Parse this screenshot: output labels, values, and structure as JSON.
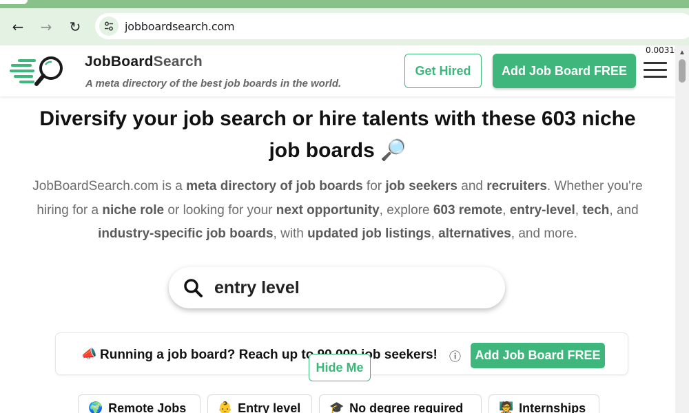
{
  "browser": {
    "back_glyph": "←",
    "forward_glyph": "→",
    "reload_glyph": "↻",
    "url": "jobboardsearch.com"
  },
  "header": {
    "brand_main": "JobBoard",
    "brand_accent": "Search",
    "tagline": "A meta directory of the best job boards in the world.",
    "get_hired_label": "Get Hired",
    "add_board_label": "Add Job Board FREE",
    "timing": "0.0031s"
  },
  "main": {
    "headline": "Diversify your job search or hire talents with these 603 niche job boards",
    "headline_emoji": "🔎",
    "intro": [
      {
        "t": "JobBoardSearch.com is a ",
        "b": false
      },
      {
        "t": "meta directory of job boards",
        "b": true
      },
      {
        "t": " for ",
        "b": false
      },
      {
        "t": "job seekers",
        "b": true
      },
      {
        "t": " and ",
        "b": false
      },
      {
        "t": "recruiters",
        "b": true
      },
      {
        "t": ". Whether you're hiring for a ",
        "b": false
      },
      {
        "t": "niche role",
        "b": true
      },
      {
        "t": " or looking for your ",
        "b": false
      },
      {
        "t": "next opportunity",
        "b": true
      },
      {
        "t": ", explore ",
        "b": false
      },
      {
        "t": "603 remote",
        "b": true
      },
      {
        "t": ", ",
        "b": false
      },
      {
        "t": "entry-level",
        "b": true
      },
      {
        "t": ", ",
        "b": false
      },
      {
        "t": "tech",
        "b": true
      },
      {
        "t": ", and ",
        "b": false
      },
      {
        "t": "industry-specific job boards",
        "b": true
      },
      {
        "t": ", with ",
        "b": false
      },
      {
        "t": "updated job listings",
        "b": true
      },
      {
        "t": ", ",
        "b": false
      },
      {
        "t": "alternatives",
        "b": true
      },
      {
        "t": ", and more.",
        "b": false
      }
    ],
    "search_value": "entry level"
  },
  "promo": {
    "icon": "📣",
    "text": "Running a job board? Reach up to 90,000 job seekers!",
    "info_glyph": "ⓘ",
    "button_label": "Add Job Board FREE",
    "hide_label": "Hide Me"
  },
  "chips": [
    {
      "icon": "🌍",
      "label": "Remote Jobs"
    },
    {
      "icon": "👶",
      "label": "Entry level"
    },
    {
      "icon": "🎓",
      "label": "No degree required"
    },
    {
      "icon": "🧑‍🏫",
      "label": "Internships"
    }
  ],
  "colors": {
    "brand_green": "#3fb67c",
    "chrome_green": "#89c18a",
    "chrome_bar": "#e4f2e3"
  }
}
